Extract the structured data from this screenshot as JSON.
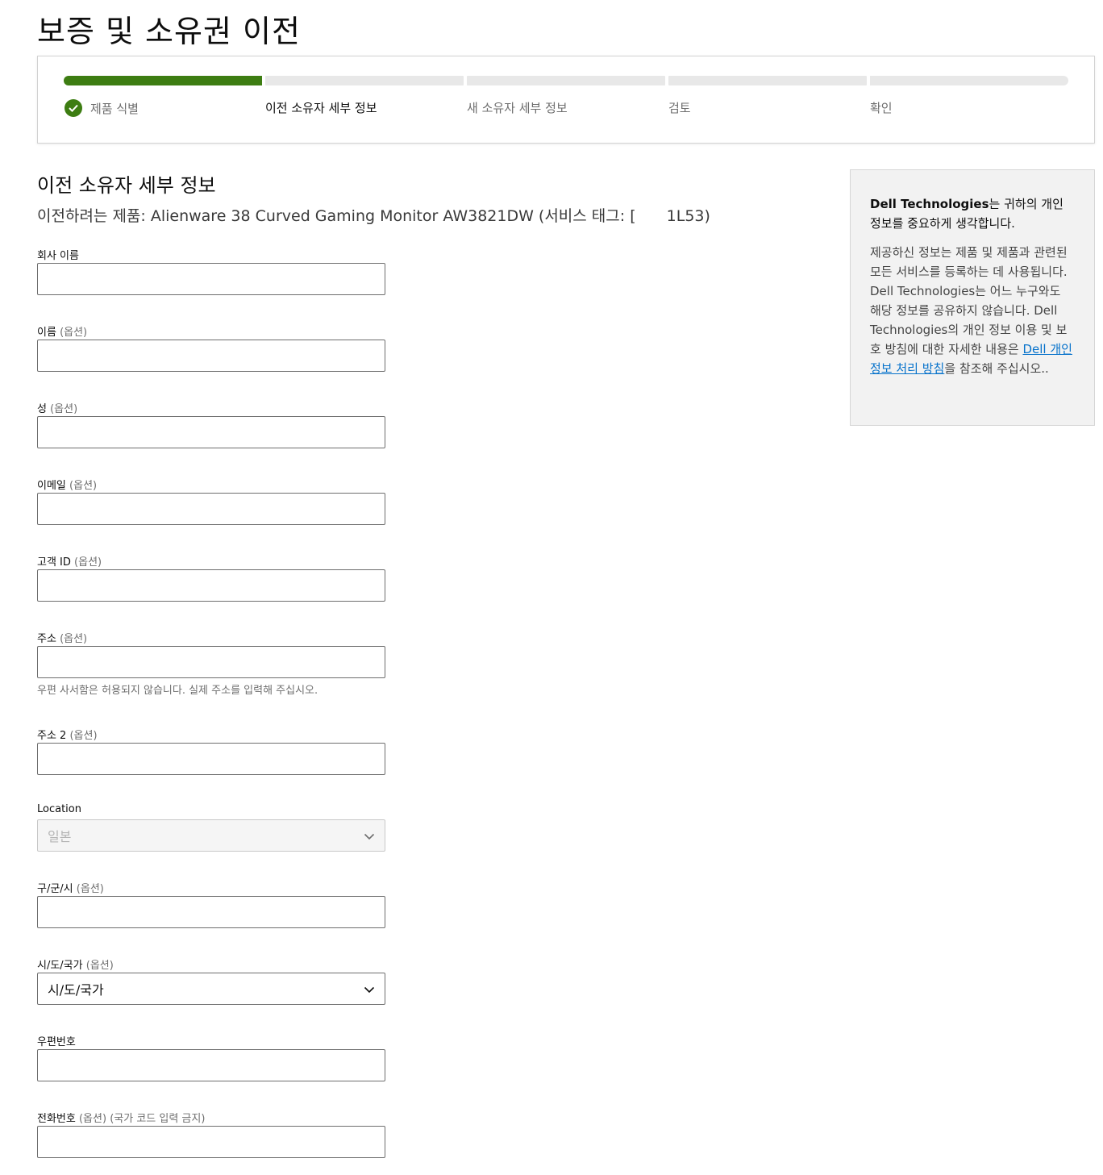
{
  "page": {
    "title": "보증 및 소유권 이전"
  },
  "stepper": {
    "steps": [
      {
        "label": "제품 식별",
        "state": "completed"
      },
      {
        "label": "이전 소유자 세부 정보",
        "state": "current"
      },
      {
        "label": "새 소유자 세부 정보",
        "state": "upcoming"
      },
      {
        "label": "검토",
        "state": "upcoming"
      },
      {
        "label": "확인",
        "state": "upcoming"
      }
    ],
    "completed_color": "#3d7d12",
    "pending_color": "#e8e8e8"
  },
  "section": {
    "title": "이전 소유자 세부 정보",
    "product_prefix": "이전하려는 제품: Alienware 38 Curved Gaming Monitor AW3821DW (서비스 태그: ",
    "product_partial": "[",
    "product_suffix": "1L53)"
  },
  "form": {
    "optional_text": "(옵션)",
    "company": {
      "label": "회사 이름",
      "value": ""
    },
    "first_name": {
      "label": "이름",
      "value": ""
    },
    "last_name": {
      "label": "성",
      "value": ""
    },
    "email": {
      "label": "이메일",
      "value": ""
    },
    "customer_id": {
      "label": "고객 ID",
      "value": ""
    },
    "address": {
      "label": "주소",
      "value": "",
      "helper": "우편 사서함은 허용되지 않습니다. 실제 주소를 입력해 주십시오."
    },
    "address2": {
      "label": "주소 2",
      "value": ""
    },
    "location": {
      "label": "Location",
      "selected": "일본",
      "disabled": true
    },
    "city": {
      "label": "구/군/시",
      "value": ""
    },
    "state": {
      "label": "시/도/국가",
      "selected": "시/도/국가"
    },
    "postal": {
      "label": "우편번호",
      "value": ""
    },
    "phone": {
      "label": "전화번호",
      "note": "(국가 코드 입력 금지)",
      "value": ""
    }
  },
  "privacy": {
    "brand": "Dell Technologies",
    "head_rest": "는 귀하의 개인 정보를 중요하게 생각합니다.",
    "body_before_link": "제공하신 정보는 제품 및 제품과 관련된 모든 서비스를 등록하는 데 사용됩니다. Dell Technologies는 어느 누구와도 해당 정보를 공유하지 않습니다. Dell Technologies의 개인 정보 이용 및 보호 방침에 대한 자세한 내용은 ",
    "link_text": "Dell 개인 정보 처리 방침",
    "body_after_link": "을 참조해 주십시오.."
  }
}
